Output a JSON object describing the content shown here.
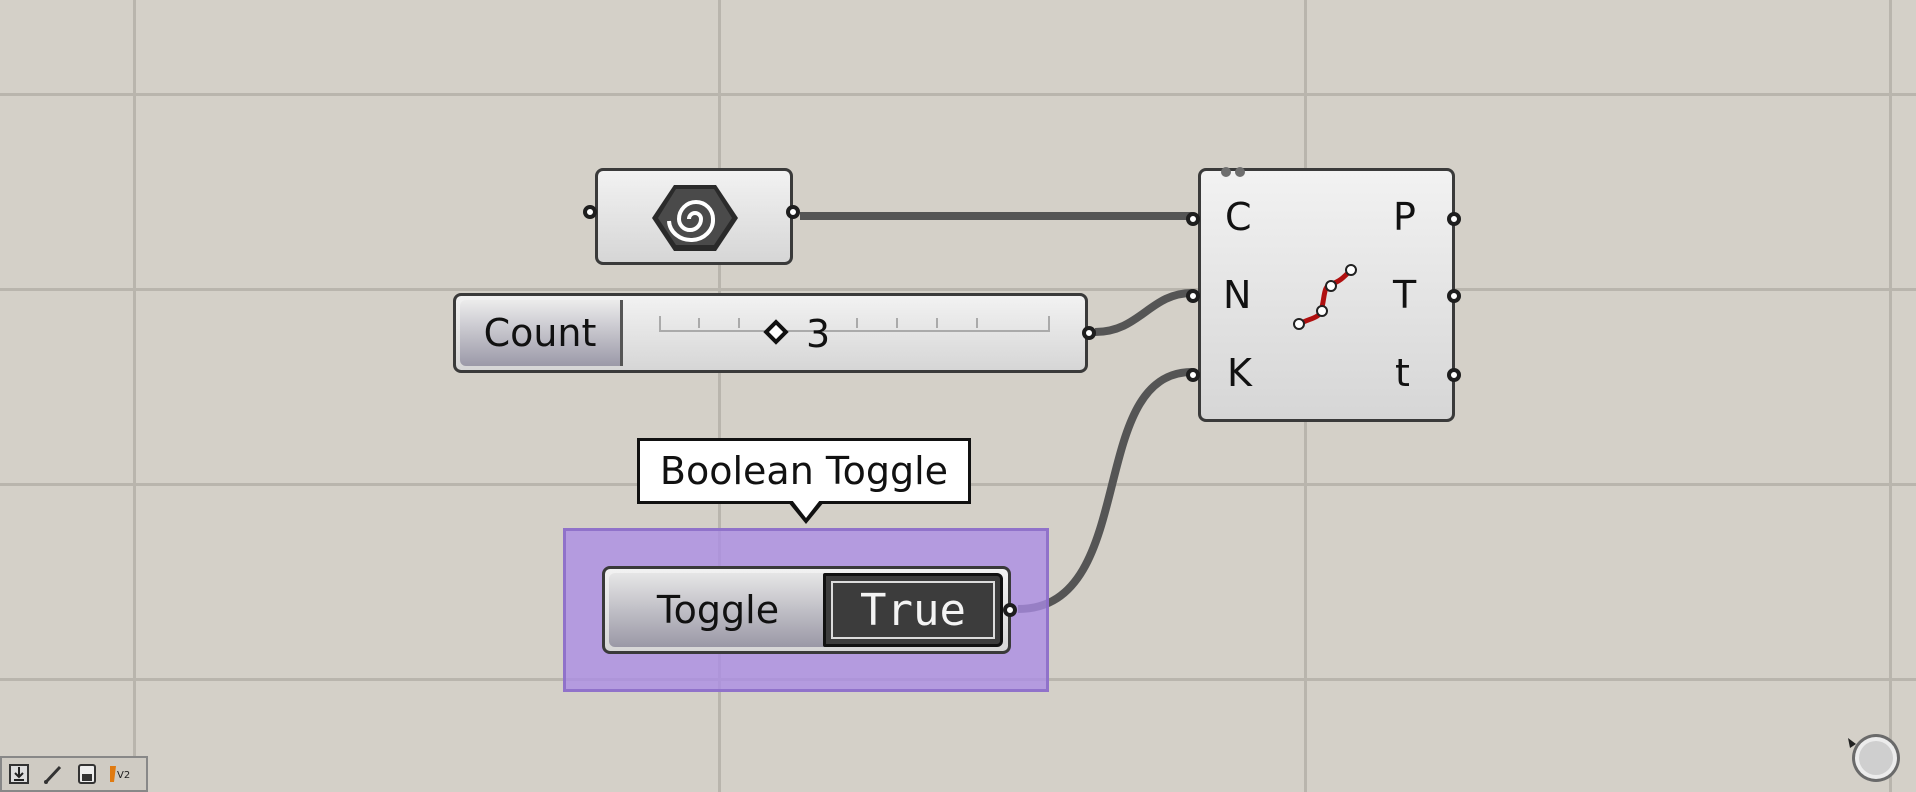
{
  "canvas": {
    "background_color": "#d4d0c8",
    "grid_color": "#b9b5ad",
    "wire_color": "#555555",
    "group_color": "#aa8ce6"
  },
  "curve_param": {
    "icon": "curve-spiral-hex-icon"
  },
  "slider": {
    "name": "Count",
    "value": "3",
    "knob_icon": "diamond-icon"
  },
  "tooltip": {
    "text": "Boolean Toggle"
  },
  "toggle": {
    "name": "Toggle",
    "value": "True"
  },
  "divide_curve": {
    "inputs": [
      "C",
      "N",
      "K"
    ],
    "outputs": [
      "P",
      "T",
      "t"
    ],
    "icon": "divide-curve-icon"
  },
  "toolbar": {
    "buttons": [
      "import-icon",
      "pen-icon",
      "save-icon",
      "version-icon"
    ],
    "version_label": "V2"
  },
  "nav": {
    "icon": "canvas-navigator-icon"
  }
}
